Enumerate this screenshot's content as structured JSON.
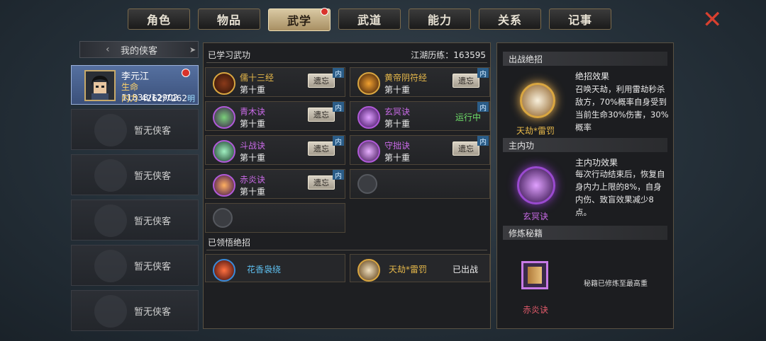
{
  "tabs": [
    {
      "label": "角色",
      "active": false,
      "badge": false
    },
    {
      "label": "物品",
      "active": false,
      "badge": false
    },
    {
      "label": "武学",
      "active": true,
      "badge": true
    },
    {
      "label": "武道",
      "active": false,
      "badge": false
    },
    {
      "label": "能力",
      "active": false,
      "badge": false
    },
    {
      "label": "关系",
      "active": false,
      "badge": false
    },
    {
      "label": "记事",
      "active": false,
      "badge": false
    }
  ],
  "close_label": "✕",
  "left": {
    "header": "我的侠客",
    "character": {
      "name": "李元江",
      "hp_label": "生命",
      "hp_value": "11838/12902",
      "mp_label": "内力",
      "mp_value": "4262/7262",
      "tag": "明"
    },
    "empty_slots": [
      "暂无侠客",
      "暂无侠客",
      "暂无侠客",
      "暂无侠客",
      "暂无侠客"
    ]
  },
  "middle": {
    "learned_title": "已学习武功",
    "exp_label": "江湖历练：163595",
    "skills": [
      {
        "name": "儒十三经",
        "level": "第十重",
        "action": "遗忘",
        "tag": "内",
        "color": "#e6b84a"
      },
      {
        "name": "黄帝阴符经",
        "level": "第十重",
        "action": "遗忘",
        "tag": "内",
        "color": "#e6b84a"
      },
      {
        "name": "青木诀",
        "level": "第十重",
        "action": "遗忘",
        "tag": "内",
        "color": "#c86ae6"
      },
      {
        "name": "玄冥诀",
        "level": "第十重",
        "action": "运行中",
        "tag": "内",
        "color": "#c86ae6"
      },
      {
        "name": "斗战诀",
        "level": "第十重",
        "action": "遗忘",
        "tag": "内",
        "color": "#c86ae6"
      },
      {
        "name": "守拙诀",
        "level": "第十重",
        "action": "遗忘",
        "tag": "内",
        "color": "#c86ae6"
      },
      {
        "name": "赤炎诀",
        "level": "第十重",
        "action": "遗忘",
        "tag": "内",
        "color": "#c86ae6"
      }
    ],
    "comprehended_title": "已领悟绝招",
    "ultimates": [
      {
        "name": "花香袅绕",
        "status": "",
        "color": "#5fc0f0"
      },
      {
        "name": "天劫*雷罚",
        "status": "已出战",
        "color": "#e6b84a"
      }
    ]
  },
  "right": {
    "battle_title": "出战绝招",
    "battle_effect_title": "绝招效果",
    "battle_effect_desc": "召唤天劫，利用雷劫秒杀敌方，70%概率自身受到当前生命30%伤害，30%概率",
    "battle_skill_name": "天劫*雷罚",
    "main_title": "主内功",
    "main_effect_title": "主内功效果",
    "main_effect_desc": "每次行动结束后，恢复自身内力上限的8%，自身内伤、致盲效果减少8点。",
    "main_skill_name": "玄冥诀",
    "cultivate_title": "修炼秘籍",
    "cultivate_note": "秘籍已修炼至最高重",
    "cultivate_skill_name": "赤炎诀"
  }
}
